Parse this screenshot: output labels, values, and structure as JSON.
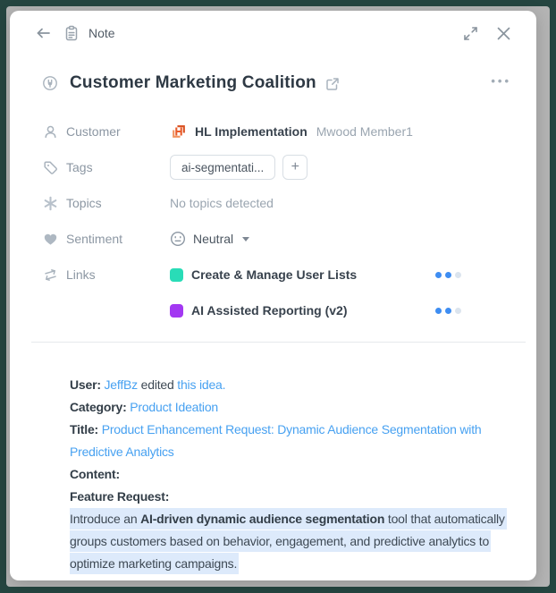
{
  "frame": {
    "outer_color": "#254540",
    "page_bg": "#b4b4b4"
  },
  "header": {
    "title": "Note"
  },
  "note": {
    "title": "Customer Marketing Coalition",
    "menu": "•••"
  },
  "fields": {
    "customer": {
      "label": "Customer",
      "company": "HL Implementation",
      "member": "Mwood Member1",
      "logo_letter": "H",
      "logo_color": "#e85c2b"
    },
    "tags": {
      "label": "Tags",
      "chip": "ai-segmentati...",
      "add_label": "+"
    },
    "topics": {
      "label": "Topics",
      "value": "No topics detected"
    },
    "sentiment": {
      "label": "Sentiment",
      "value": "Neutral"
    },
    "links": {
      "label": "Links",
      "items": [
        {
          "name": "Create & Manage User Lists",
          "color": "#29dcb7",
          "dots": [
            "#3e8df2",
            "#3e8df2",
            "#dbe4ee"
          ]
        },
        {
          "name": "AI Assisted Reporting (v2)",
          "color": "#a338f2",
          "dots": [
            "#3e8df2",
            "#3e8df2",
            "#dbe4ee"
          ]
        }
      ]
    }
  },
  "body": {
    "user_label": "User:",
    "user_name": "JeffBz",
    "user_mid": " edited ",
    "user_link": "this idea.",
    "category_label": "Category:",
    "category_value": "Product Ideation",
    "title_label": "Title:",
    "title_value": "Product Enhancement Request: Dynamic Audience Segmentation with Predictive Analytics",
    "content_label": "Content:",
    "feature_label": "Feature Request:",
    "highlight_pre": "Introduce an ",
    "highlight_bold": "AI-driven dynamic audience segmentation",
    "highlight_post": " tool that automatically groups customers based on behavior, engagement, and predictive analytics to optimize marketing campaigns."
  }
}
